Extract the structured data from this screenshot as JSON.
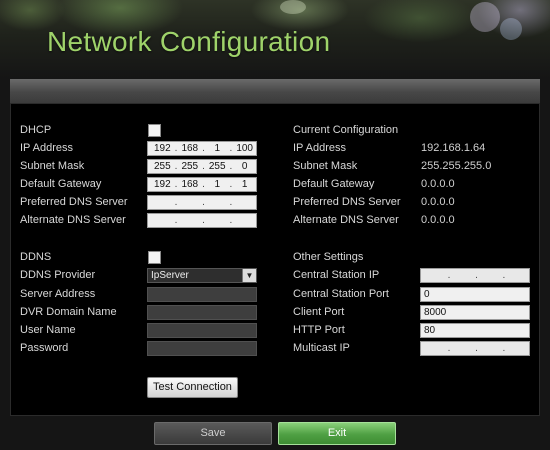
{
  "window": {
    "title": "Network Configuration"
  },
  "network": {
    "dhcp_label": "DHCP",
    "dhcp_checked": false,
    "ip_label": "IP Address",
    "ip": [
      "192",
      "168",
      "1",
      "100"
    ],
    "subnet_label": "Subnet Mask",
    "subnet": [
      "255",
      "255",
      "255",
      "0"
    ],
    "gateway_label": "Default Gateway",
    "gateway": [
      "192",
      "168",
      "1",
      "1"
    ],
    "pdns_label": "Preferred DNS Server",
    "pdns": [
      "",
      "",
      "",
      ""
    ],
    "adns_label": "Alternate DNS Server",
    "adns": [
      "",
      "",
      "",
      ""
    ]
  },
  "current": {
    "heading": "Current Configuration",
    "ip_label": "IP Address",
    "ip_value": "192.168.1.64",
    "subnet_label": "Subnet Mask",
    "subnet_value": "255.255.255.0",
    "gateway_label": "Default Gateway",
    "gateway_value": "0.0.0.0",
    "pdns_label": "Preferred DNS Server",
    "pdns_value": "0.0.0.0",
    "adns_label": "Alternate DNS Server",
    "adns_value": "0.0.0.0"
  },
  "ddns": {
    "ddns_label": "DDNS",
    "ddns_checked": false,
    "provider_label": "DDNS Provider",
    "provider_value": "IpServer",
    "server_label": "Server Address",
    "server_value": "",
    "domain_label": "DVR Domain Name",
    "domain_value": "",
    "user_label": "User Name",
    "user_value": "",
    "password_label": "Password",
    "password_value": "",
    "test_button": "Test Connection"
  },
  "other": {
    "heading": "Other Settings",
    "central_ip_label": "Central Station IP",
    "central_ip": [
      "",
      "",
      "",
      ""
    ],
    "central_port_label": "Central Station Port",
    "central_port_value": "0",
    "client_port_label": "Client Port",
    "client_port_value": "8000",
    "http_port_label": "HTTP Port",
    "http_port_value": "80",
    "multicast_label": "Multicast IP",
    "multicast_ip": [
      "",
      "",
      "",
      ""
    ]
  },
  "footer": {
    "save_label": "Save",
    "exit_label": "Exit"
  },
  "colors": {
    "title": "#9fd36a",
    "exit_button": "#4fa043",
    "panel_bg": "#000000"
  }
}
